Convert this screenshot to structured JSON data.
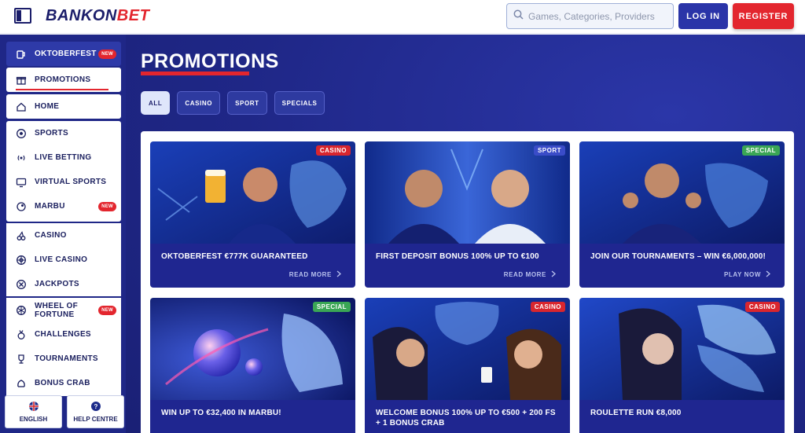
{
  "brand": {
    "name_part1": "BANKON",
    "name_part2": "BET"
  },
  "header": {
    "search_placeholder": "Games, Categories, Providers",
    "login_label": "LOG IN",
    "register_label": "REGISTER"
  },
  "sidebar": {
    "featured": {
      "label": "OKTOBERFEST",
      "badge": "NEW"
    },
    "promotions": {
      "label": "PROMOTIONS"
    },
    "home": {
      "label": "HOME"
    },
    "sports": [
      {
        "label": "SPORTS"
      },
      {
        "label": "LIVE BETTING"
      },
      {
        "label": "VIRTUAL SPORTS"
      },
      {
        "label": "MARBU",
        "badge": "NEW"
      }
    ],
    "casino": [
      {
        "label": "CASINO"
      },
      {
        "label": "LIVE CASINO"
      },
      {
        "label": "JACKPOTS"
      }
    ],
    "extras": [
      {
        "label": "WHEEL OF FORTUNE",
        "badge": "NEW"
      },
      {
        "label": "CHALLENGES"
      },
      {
        "label": "TOURNAMENTS"
      },
      {
        "label": "BONUS CRAB"
      }
    ],
    "language_label": "ENGLISH",
    "help_label": "HELP CENTRE"
  },
  "main": {
    "title": "PROMOTIONS",
    "filters": [
      "ALL",
      "CASINO",
      "SPORT",
      "SPECIALS"
    ],
    "active_filter": "ALL",
    "cards": [
      {
        "title": "OKTOBERFEST €777K GUARANTEED",
        "tag": "CASINO",
        "cta": "READ MORE"
      },
      {
        "title": "FIRST DEPOSIT BONUS 100% UP TO €100",
        "tag": "SPORT",
        "cta": "READ MORE"
      },
      {
        "title": "JOIN OUR TOURNAMENTS – WIN €6,000,000!",
        "tag": "SPECIAL",
        "cta": "PLAY NOW"
      },
      {
        "title": "WIN UP TO €32,400 IN MARBU!",
        "tag": "SPECIAL",
        "cta": ""
      },
      {
        "title": "WELCOME BONUS 100% UP TO €500 + 200 FS + 1 BONUS CRAB",
        "tag": "CASINO",
        "cta": ""
      },
      {
        "title": "ROULETTE RUN €8,000",
        "tag": "CASINO",
        "cta": ""
      }
    ]
  },
  "colors": {
    "brand_navy": "#1f2787",
    "accent_red": "#e3262e",
    "login_blue": "#2a34a8",
    "special_green": "#3aa655",
    "sport_blue": "#3a4cc8"
  }
}
